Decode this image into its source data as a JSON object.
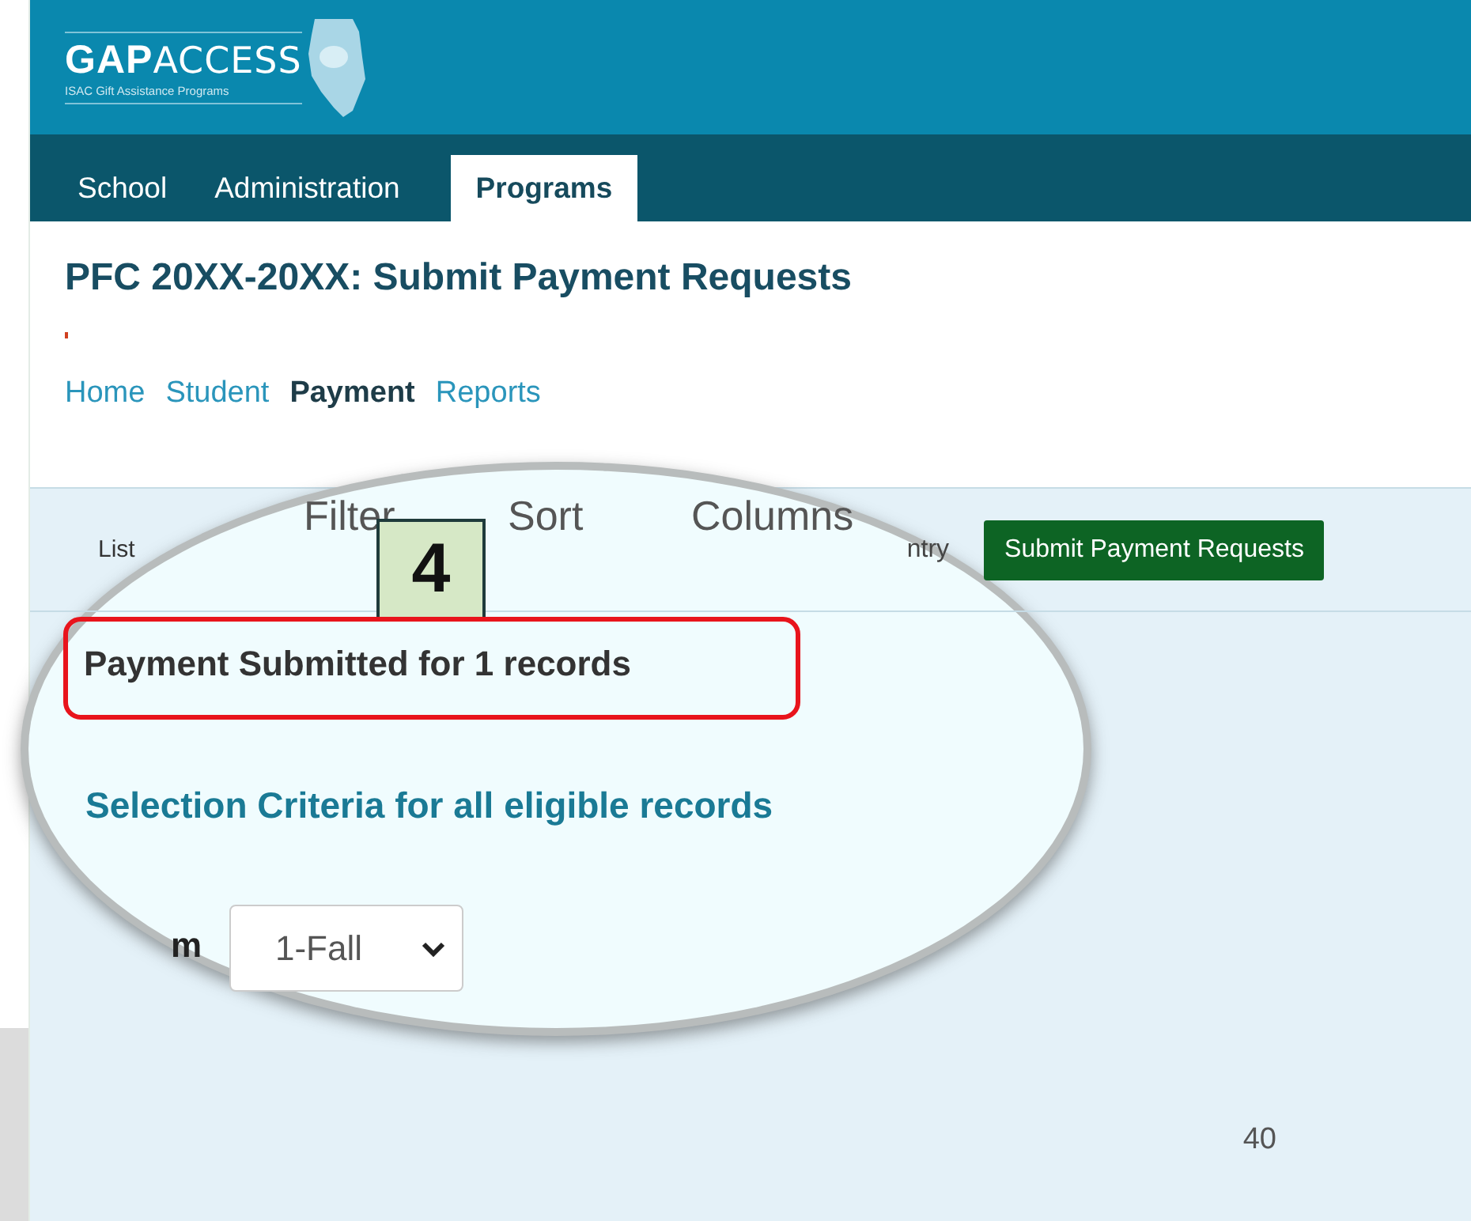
{
  "header": {
    "logo_bold": "GAP",
    "logo_light": "ACCESS",
    "logo_subtitle": "ISAC Gift Assistance Programs"
  },
  "main_tabs": [
    {
      "label": "School",
      "selected": false
    },
    {
      "label": "Administration",
      "selected": false
    },
    {
      "label": "Programs",
      "selected": true
    }
  ],
  "page_title": "PFC 20XX-20XX: Submit Payment Requests",
  "sub_nav": [
    {
      "label": "Home",
      "selected": false
    },
    {
      "label": "Student",
      "selected": false
    },
    {
      "label": "Payment",
      "selected": true
    },
    {
      "label": "Reports",
      "selected": false
    }
  ],
  "toolbar": {
    "list_label": "List",
    "partial_label": "ntry",
    "submit_button": "Submit Payment Requests"
  },
  "magnifier": {
    "toolbar_items": [
      "Filter",
      "Sort",
      "Columns"
    ],
    "step_badge": "4",
    "message": "Payment Submitted for 1 records",
    "section_heading": "Selection Criteria for all eligible records",
    "field_label_partial": "m",
    "term_select": {
      "value": "1-Fall"
    }
  },
  "page_number": "40"
}
